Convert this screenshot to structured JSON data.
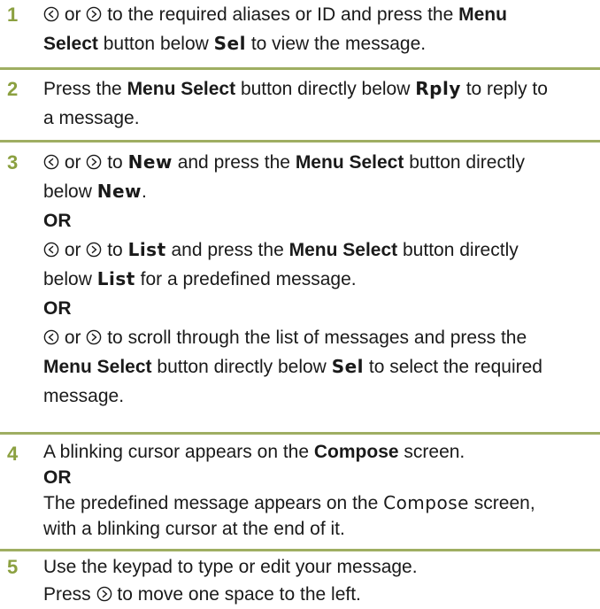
{
  "steps": [
    {
      "number": "1",
      "line1": {
        "or": "or",
        "text": "to the required aliases or ID and press the",
        "bold": "Menu"
      },
      "line2": {
        "bold": "Select",
        "text1": "button below",
        "lcd": "Sel",
        "text2": "to view the message."
      }
    },
    {
      "number": "2",
      "line1": {
        "text1": "Press the",
        "bold": "Menu Select",
        "text2": "button directly below",
        "lcd": "Rply",
        "text3": "to reply to"
      },
      "line2": {
        "text": "a message."
      }
    },
    {
      "number": "3",
      "a1": {
        "or": "or",
        "to": "to",
        "lcd": "New",
        "text1": "and press the",
        "bold": "Menu Select",
        "text2": "button directly"
      },
      "a2": {
        "text": "below",
        "lcd": "New",
        "dot": "."
      },
      "or1": "OR",
      "b1": {
        "or": "or",
        "to": "to",
        "lcd": "List",
        "text1": "and press the",
        "bold": "Menu Select",
        "text2": "button directly"
      },
      "b2": {
        "text1": "below",
        "lcd": "List",
        "text2": "for a predefined message."
      },
      "or2": "OR",
      "c1": {
        "or": "or",
        "text": "to scroll through the list of messages and press the"
      },
      "c2": {
        "bold": "Menu Select",
        "text1": "button directly below",
        "lcd": "Sel",
        "text2": "to select the required"
      },
      "c3": {
        "text": "message."
      }
    },
    {
      "number": "4",
      "l1": {
        "text1": "A blinking cursor appears on the",
        "bold": "Compose",
        "text2": "screen."
      },
      "or": "OR",
      "l2": {
        "text1": "The predefined message appears on the",
        "lcd": "Compose",
        "text2": "screen,"
      },
      "l3": {
        "text": "with a blinking cursor at the end of it."
      }
    },
    {
      "number": "5",
      "l1": {
        "text": "Use the keypad to type or edit your message."
      },
      "l2": {
        "text1": "Press",
        "text2": "to move one space to the left."
      }
    }
  ],
  "icons": {
    "left": "nav-left-icon",
    "right": "nav-right-icon"
  },
  "colors": {
    "step_number": "#8ba040",
    "rule": "#9fae62",
    "text": "#1a1a1a"
  }
}
